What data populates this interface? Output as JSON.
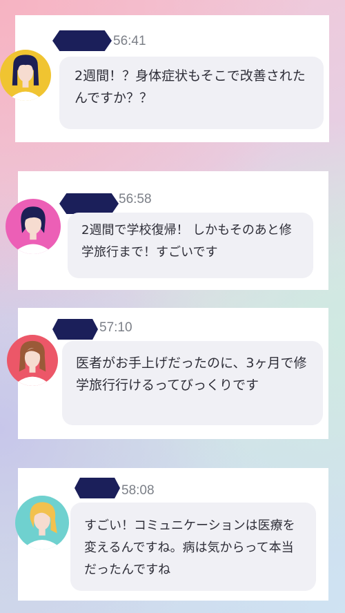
{
  "messages": [
    {
      "time": "56:41",
      "avatar_icon": "woman-dark-hair-icon",
      "avatar_bg": "#f0c431",
      "text": "2週間！？身体症状もそこで改善されたんですか？？"
    },
    {
      "time": "56:58",
      "avatar_icon": "woman-navy-hair-icon",
      "avatar_bg": "#ec5fb6",
      "text": "2週間で学校復帰！ しかもそのあと修学旅行まで！すごいです"
    },
    {
      "time": "57:10",
      "avatar_icon": "woman-brown-hair-icon",
      "avatar_bg": "#ec5768",
      "text": "医者がお手上げだったのに、3ヶ月で修学旅行行けるってびっくりです"
    },
    {
      "time": "58:08",
      "avatar_icon": "woman-blonde-hair-icon",
      "avatar_bg": "#6fd1cf",
      "text": "すごい！コミュニケーションは医療を変えるんですね。病は気からって本当だったんですね"
    }
  ]
}
